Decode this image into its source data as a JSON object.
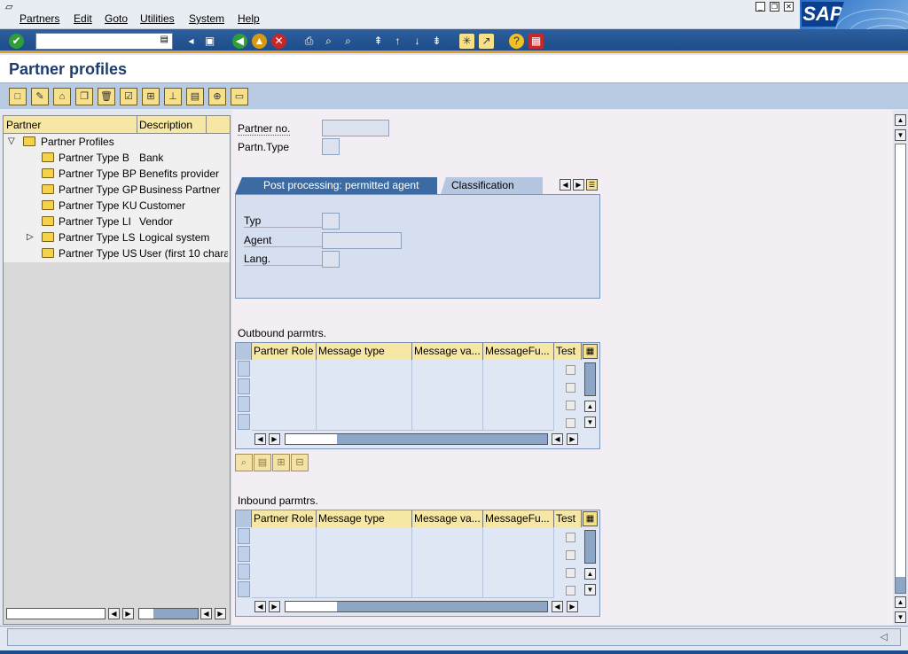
{
  "menubar": {
    "items": [
      "Partners",
      "Edit",
      "Goto",
      "Utilities",
      "System",
      "Help"
    ]
  },
  "logo": "SAP",
  "page_title": "Partner profiles",
  "tree": {
    "headers": [
      "Partner",
      "Description"
    ],
    "root": "Partner Profiles",
    "rows": [
      {
        "partner": "Partner Type B",
        "desc": "Bank"
      },
      {
        "partner": "Partner Type BP",
        "desc": "Benefits provider"
      },
      {
        "partner": "Partner Type GP",
        "desc": "Business Partner"
      },
      {
        "partner": "Partner Type KU",
        "desc": "Customer"
      },
      {
        "partner": "Partner Type LI",
        "desc": "Vendor"
      },
      {
        "partner": "Partner Type LS",
        "desc": "Logical system"
      },
      {
        "partner": "Partner Type US",
        "desc": "User (first 10 chara"
      }
    ]
  },
  "form": {
    "partner_no_label": "Partner no.",
    "partn_type_label": "Partn.Type"
  },
  "tabs": [
    "Post processing: permitted agent",
    "Classification"
  ],
  "agent": {
    "typ_label": "Typ",
    "agent_label": "Agent",
    "lang_label": "Lang."
  },
  "outbound": {
    "title": "Outbound parmtrs.",
    "columns": [
      "Partner Role",
      "Message type",
      "Message va...",
      "MessageFu...",
      "Test"
    ]
  },
  "inbound": {
    "title": "Inbound parmtrs.",
    "columns": [
      "Partner Role",
      "Message type",
      "Message va...",
      "MessageFu...",
      "Test"
    ]
  },
  "colors": {
    "accent": "#e39b2c",
    "toolbar": "#1d4d8a",
    "title": "#1e3c6e"
  }
}
